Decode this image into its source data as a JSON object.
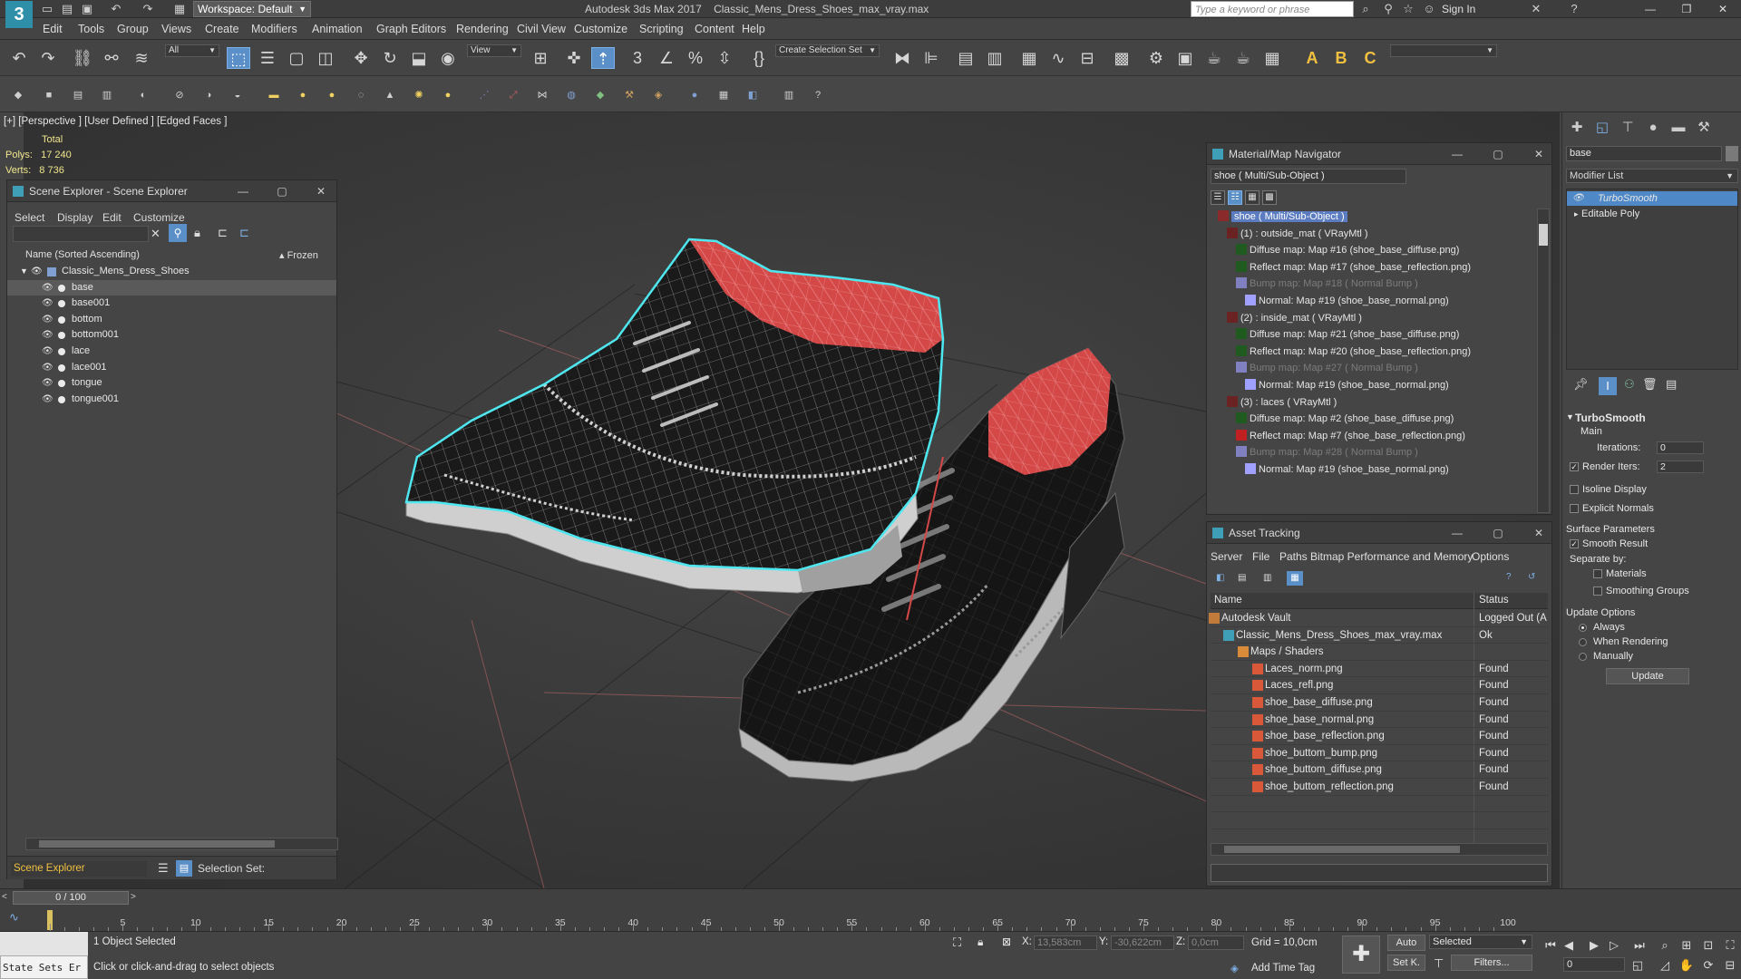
{
  "titlebar": {
    "workspace": "Workspace: Default",
    "app_title": "Autodesk 3ds Max 2017",
    "file_title": "Classic_Mens_Dress_Shoes_max_vray.max",
    "search_placeholder": "Type a keyword or phrase",
    "sign_in": "Sign In",
    "logo_text": "3"
  },
  "menu": [
    "Edit",
    "Tools",
    "Group",
    "Views",
    "Create",
    "Modifiers",
    "Animation",
    "Graph Editors",
    "Rendering",
    "Civil View",
    "Customize",
    "Scripting",
    "Content",
    "Help"
  ],
  "toolbar": {
    "filter": "All",
    "ref_coord": "View",
    "selection_set": "Create Selection Set",
    "text_icons": [
      "A",
      "B",
      "C"
    ]
  },
  "viewport": {
    "label": "[+] [Perspective ] [User Defined ] [Edged Faces ]",
    "stats_total": "Total",
    "polys_label": "Polys:",
    "polys": "17 240",
    "verts_label": "Verts:",
    "verts": "8 736"
  },
  "scene_explorer": {
    "title": "Scene Explorer - Scene Explorer",
    "menus": [
      "Select",
      "Display",
      "Edit",
      "Customize"
    ],
    "col_name": "Name (Sorted Ascending)",
    "col_frozen": "▴ Frozen",
    "root": "Classic_Mens_Dress_Shoes",
    "objects": [
      "base",
      "base001",
      "bottom",
      "bottom001",
      "lace",
      "lace001",
      "tongue",
      "tongue001"
    ],
    "selected_index": 0,
    "explorer_name": "Scene Explorer",
    "selection_set_label": "Selection Set:"
  },
  "material_navigator": {
    "title": "Material/Map Navigator",
    "field": "shoe  ( Multi/Sub-Object )",
    "items": [
      {
        "text": "shoe  ( Multi/Sub-Object )",
        "level": 0,
        "selected": true,
        "dim": false,
        "swatch": "#8a2a2a"
      },
      {
        "text": "(1) : outside_mat  ( VRayMtl )",
        "level": 1,
        "selected": false,
        "dim": false,
        "swatch": "#6a2222"
      },
      {
        "text": "Diffuse map: Map #16 (shoe_base_diffuse.png)",
        "level": 2,
        "selected": false,
        "dim": false,
        "swatch": "#1f5a1f"
      },
      {
        "text": "Reflect map: Map #17 (shoe_base_reflection.png)",
        "level": 2,
        "selected": false,
        "dim": false,
        "swatch": "#1f5a1f"
      },
      {
        "text": "Bump map: Map #18  ( Normal Bump )",
        "level": 2,
        "selected": false,
        "dim": true,
        "swatch": "#8080c0"
      },
      {
        "text": "Normal: Map #19 (shoe_base_normal.png)",
        "level": 3,
        "selected": false,
        "dim": false,
        "swatch": "#a0a0ff"
      },
      {
        "text": "(2) : inside_mat  ( VRayMtl )",
        "level": 1,
        "selected": false,
        "dim": false,
        "swatch": "#6a2222"
      },
      {
        "text": "Diffuse map: Map #21 (shoe_base_diffuse.png)",
        "level": 2,
        "selected": false,
        "dim": false,
        "swatch": "#1f5a1f"
      },
      {
        "text": "Reflect map: Map #20 (shoe_base_reflection.png)",
        "level": 2,
        "selected": false,
        "dim": false,
        "swatch": "#1f5a1f"
      },
      {
        "text": "Bump map: Map #27  ( Normal Bump )",
        "level": 2,
        "selected": false,
        "dim": true,
        "swatch": "#8080c0"
      },
      {
        "text": "Normal: Map #19 (shoe_base_normal.png)",
        "level": 3,
        "selected": false,
        "dim": false,
        "swatch": "#a0a0ff"
      },
      {
        "text": "(3) : laces  ( VRayMtl )",
        "level": 1,
        "selected": false,
        "dim": false,
        "swatch": "#6a2222"
      },
      {
        "text": "Diffuse map: Map #2 (shoe_base_diffuse.png)",
        "level": 2,
        "selected": false,
        "dim": false,
        "swatch": "#1f5a1f"
      },
      {
        "text": "Reflect map: Map #7 (shoe_base_reflection.png)",
        "level": 2,
        "selected": false,
        "dim": false,
        "swatch": "#c02020"
      },
      {
        "text": "Bump map: Map #28  ( Normal Bump )",
        "level": 2,
        "selected": false,
        "dim": true,
        "swatch": "#8080c0"
      },
      {
        "text": "Normal: Map #19 (shoe_base_normal.png)",
        "level": 3,
        "selected": false,
        "dim": false,
        "swatch": "#a0a0ff"
      }
    ]
  },
  "asset_tracking": {
    "title": "Asset Tracking",
    "menus": [
      "Server",
      "File",
      "Paths",
      "Bitmap Performance and Memory",
      "Options"
    ],
    "col_name": "Name",
    "col_status": "Status",
    "rows": [
      {
        "name": "Autodesk Vault",
        "status": "Logged Out (A",
        "level": 0
      },
      {
        "name": "Classic_Mens_Dress_Shoes_max_vray.max",
        "status": "Ok",
        "level": 1
      },
      {
        "name": "Maps / Shaders",
        "status": "",
        "level": 2
      },
      {
        "name": "Laces_norm.png",
        "status": "Found",
        "level": 3
      },
      {
        "name": "Laces_refl.png",
        "status": "Found",
        "level": 3
      },
      {
        "name": "shoe_base_diffuse.png",
        "status": "Found",
        "level": 3
      },
      {
        "name": "shoe_base_normal.png",
        "status": "Found",
        "level": 3
      },
      {
        "name": "shoe_base_reflection.png",
        "status": "Found",
        "level": 3
      },
      {
        "name": "shoe_buttom_bump.png",
        "status": "Found",
        "level": 3
      },
      {
        "name": "shoe_buttom_diffuse.png",
        "status": "Found",
        "level": 3
      },
      {
        "name": "shoe_buttom_reflection.png",
        "status": "Found",
        "level": 3
      },
      {
        "name": "",
        "status": "",
        "level": 0
      },
      {
        "name": "",
        "status": "",
        "level": 0
      }
    ]
  },
  "command_panel": {
    "object_name": "base",
    "modifier_list": "Modifier List",
    "stack": [
      "TurboSmooth",
      "Editable Poly"
    ],
    "rollout_title": "TurboSmooth",
    "main_label": "Main",
    "iterations_label": "Iterations:",
    "iterations": "0",
    "render_iters_label": "Render Iters:",
    "render_iters": "2",
    "isoline": "Isoline Display",
    "explicit_normals": "Explicit Normals",
    "surface_params": "Surface Parameters",
    "smooth_result": "Smooth Result",
    "separate_by": "Separate by:",
    "materials": "Materials",
    "smoothing_groups": "Smoothing Groups",
    "update_options": "Update Options",
    "always": "Always",
    "when_rendering": "When Rendering",
    "manually": "Manually",
    "update_btn": "Update"
  },
  "timeline": {
    "frame": "0 / 100",
    "ticks": [
      "0",
      "5",
      "10",
      "15",
      "20",
      "25",
      "30",
      "35",
      "40",
      "45",
      "50",
      "55",
      "60",
      "65",
      "70",
      "75",
      "80",
      "85",
      "90",
      "95",
      "100"
    ]
  },
  "status": {
    "maxscript": "State Sets Er",
    "selected": "1 Object Selected",
    "prompt": "Click or click-and-drag to select objects",
    "x_label": "X:",
    "x": "13,583cm",
    "y_label": "Y:",
    "y": "-30,622cm",
    "z_label": "Z:",
    "z": "0,0cm",
    "grid": "Grid = 10,0cm",
    "add_time_tag": "Add Time Tag",
    "auto": "Auto",
    "set_key": "Set K.",
    "key_mode": "Selected",
    "filters": "Filters...",
    "current_frame": "0"
  },
  "colors": {
    "accent": "#5b8fc7",
    "selection_outline": "#4ee7f0",
    "shoe_inner": "#d44848",
    "stats_yellow": "#f0e68c"
  }
}
